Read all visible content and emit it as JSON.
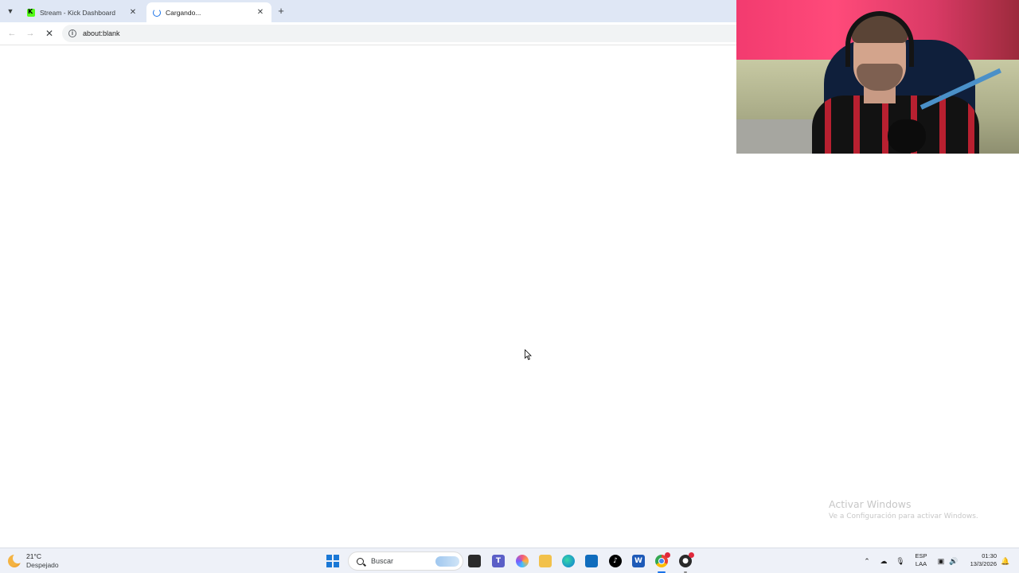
{
  "browser": {
    "tabs": [
      {
        "title": "Stream - Kick Dashboard",
        "favicon": "kick-icon",
        "active": false
      },
      {
        "title": "Cargando...",
        "favicon": "loading-spinner-icon",
        "active": true
      }
    ],
    "address_bar": {
      "url": "about:blank",
      "security_icon": "info-icon"
    },
    "nav": {
      "back": "back-arrow-icon",
      "forward": "forward-arrow-icon",
      "stop": "stop-icon"
    }
  },
  "watermark": {
    "title": "Activar Windows",
    "subtitle": "Ve a Configuración para activar Windows."
  },
  "taskbar": {
    "weather": {
      "temp": "21°C",
      "condition": "Despejado"
    },
    "search_label": "Buscar",
    "apps": [
      "windows-start-icon",
      "task-view-icon",
      "teams-icon",
      "copilot-icon",
      "file-explorer-icon",
      "edge-icon",
      "store-icon",
      "tiktok-icon",
      "word-icon",
      "chrome-icon",
      "obs-icon"
    ],
    "tray": {
      "lang_line1": "ESP",
      "lang_line2": "LAA",
      "time": "01:30",
      "date": "13/3/2026"
    }
  },
  "colors": {
    "tabstrip_bg": "#dfe7f5",
    "accent": "#1a73e8",
    "taskbar_bg": "#eef1f8",
    "kick_green": "#53fc18"
  }
}
